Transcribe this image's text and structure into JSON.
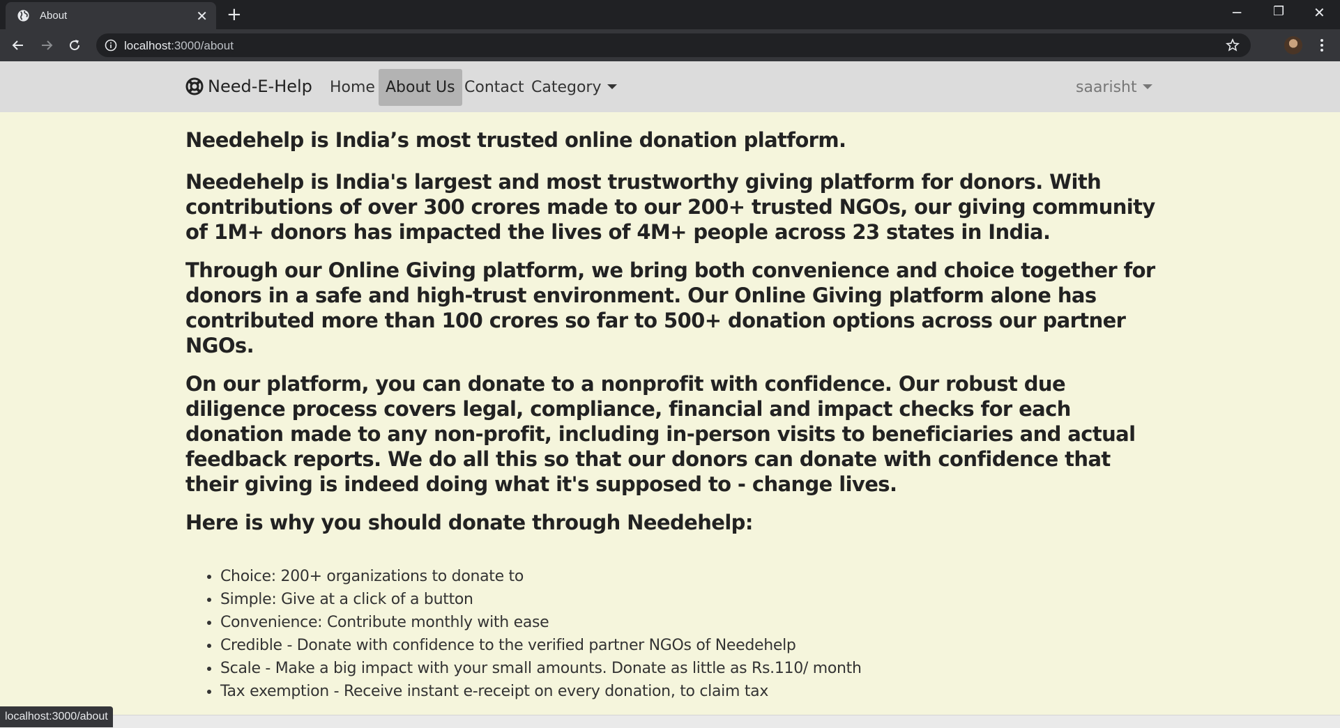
{
  "browser": {
    "tab_title": "About",
    "tab_icon": "globe-icon",
    "new_tab_label": "+",
    "url_host": "localhost",
    "url_rest": ":3000/about",
    "status_url": "localhost:3000/about"
  },
  "navbar": {
    "brand": "Need-E-Help",
    "brand_icon": "lifebuoy-icon",
    "links": [
      "Home",
      "About Us",
      "Contact",
      "Category"
    ],
    "active_link": "About Us",
    "user": "saarisht",
    "background": "#dcdcdc",
    "active_background": "#b3b3b3"
  },
  "content": {
    "heading": "Needehelp is India’s most trusted online donation platform.",
    "paragraphs": [
      "Needehelp is India's largest and most trustworthy giving platform for donors. With contributions of over 300 crores made to our 200+ trusted NGOs, our giving community of 1M+ donors has impacted the lives of 4M+ people across 23 states in India.",
      "Through our Online Giving platform, we bring both convenience and choice together for donors in a safe and high-trust environment. Our Online Giving platform alone has contributed more than 100 crores so far to 500+ donation options across our partner NGOs.",
      "On our platform, you can donate to a nonprofit with confidence. Our robust due diligence process covers legal, compliance, financial and impact checks for each donation made to any non-profit, including in-person visits to beneficiaries and actual feedback reports. We do all this so that our donors can donate with confidence that their giving is indeed doing what it's supposed to - change lives."
    ],
    "why_heading": "Here is why you should donate through Needehelp:",
    "bullets": [
      "Choice: 200+ organizations to donate to",
      "Simple: Give at a click of a button",
      "Convenience: Contribute monthly with ease",
      "Credible - Donate with confidence to the verified partner NGOs of Needehelp",
      "Scale - Make a big impact with your small amounts. Donate as little as Rs.110/ month",
      "Tax exemption - Receive instant e-receipt on every donation, to claim tax"
    ],
    "background": "#f5f5dc"
  }
}
